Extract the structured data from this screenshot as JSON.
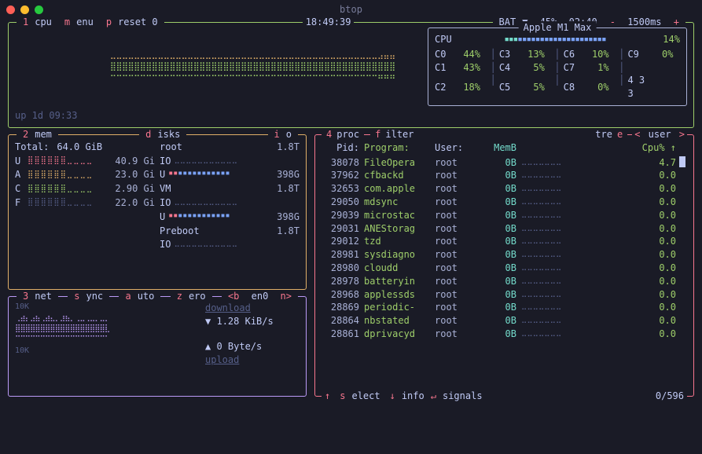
{
  "window": {
    "title": "btop"
  },
  "topbar": {
    "cpu_num": "1",
    "cpu_label": "cpu",
    "menu": {
      "hot": "m",
      "rest": "enu"
    },
    "preset": {
      "hot": "p",
      "rest": "reset 0"
    },
    "clock": "18:49:39",
    "bat_label": "BAT",
    "bat_pct": "45%",
    "bat_time": "02:40",
    "interval_minus": "-",
    "interval": "1500ms",
    "interval_plus": "+"
  },
  "cpu": {
    "model": "Apple M1 Max",
    "overall_label": "CPU",
    "overall_pct": "14%",
    "cores": [
      [
        {
          "n": "C0",
          "v": "44%"
        },
        {
          "n": "C3",
          "v": "13%"
        },
        {
          "n": "C6",
          "v": "10%"
        },
        {
          "n": "C9",
          "v": "0%"
        }
      ],
      [
        {
          "n": "C1",
          "v": "43%"
        },
        {
          "n": "C4",
          "v": "5%"
        },
        {
          "n": "C7",
          "v": "1%"
        },
        {
          "n": "",
          "v": ""
        }
      ],
      [
        {
          "n": "C2",
          "v": "18%"
        },
        {
          "n": "C5",
          "v": "5%"
        },
        {
          "n": "C8",
          "v": "0%"
        },
        {
          "n": "4 3 3",
          "v": ""
        }
      ]
    ],
    "uptime": "up 1d 09:33"
  },
  "mem": {
    "num": "2",
    "label": "mem",
    "disks_label": {
      "hot": "d",
      "rest": "isks"
    },
    "io_label": {
      "hot": "i",
      "rest": "o"
    },
    "total_label": "Total:",
    "total_val": "64.0 GiB",
    "rows": [
      {
        "l": "U",
        "dots_color": "#f7768e",
        "v": "40.9 Gi"
      },
      {
        "l": "A",
        "dots_color": "#e0af68",
        "v": "23.0 Gi"
      },
      {
        "l": "C",
        "dots_color": "#9ece6a",
        "v": "2.90 Gi"
      },
      {
        "l": "F",
        "dots_color": "#565f89",
        "v": "22.0 Gi"
      }
    ],
    "disks": [
      {
        "n": "root",
        "v": "1.8T"
      },
      {
        "n": "IO",
        "v": ""
      },
      {
        "n": "U",
        "v": "398G",
        "bar": true
      },
      {
        "n": "VM",
        "v": "1.8T"
      },
      {
        "n": "IO",
        "v": ""
      },
      {
        "n": "U",
        "v": "398G",
        "bar": true
      },
      {
        "n": "Preboot",
        "v": "1.8T"
      },
      {
        "n": "IO",
        "v": ""
      }
    ]
  },
  "net": {
    "num": "3",
    "label": "net",
    "sync": {
      "hot": "s",
      "rest": "ync"
    },
    "auto": {
      "hot": "a",
      "rest": "uto"
    },
    "zero": {
      "hot": "z",
      "rest": "ero"
    },
    "iface_prev": "<b",
    "iface": "en0",
    "iface_next": "n>",
    "scale_top": "10K",
    "scale_bot": "10K",
    "download_label": "download",
    "download_val": "1.28 KiB/s",
    "upload_val": "0 Byte/s",
    "upload_label": "upload"
  },
  "proc": {
    "num": "4",
    "label": "proc",
    "filter": {
      "hot": "f",
      "rest": "ilter"
    },
    "tree": {
      "hot": "tre",
      "rest": "e"
    },
    "user_nav": "< user >",
    "headers": {
      "pid": "Pid:",
      "prog": "Program:",
      "user": "User:",
      "mem": "MemB",
      "cpu": "Cpu% ↑"
    },
    "rows": [
      {
        "pid": "38078",
        "prog": "FileOpera",
        "user": "root",
        "mem": "0B",
        "cpu": "4.7"
      },
      {
        "pid": "37962",
        "prog": "cfbackd",
        "user": "root",
        "mem": "0B",
        "cpu": "0.0"
      },
      {
        "pid": "32653",
        "prog": "com.apple",
        "user": "root",
        "mem": "0B",
        "cpu": "0.0"
      },
      {
        "pid": "29050",
        "prog": "mdsync",
        "user": "root",
        "mem": "0B",
        "cpu": "0.0"
      },
      {
        "pid": "29039",
        "prog": "microstac",
        "user": "root",
        "mem": "0B",
        "cpu": "0.0"
      },
      {
        "pid": "29031",
        "prog": "ANEStorag",
        "user": "root",
        "mem": "0B",
        "cpu": "0.0"
      },
      {
        "pid": "29012",
        "prog": "tzd",
        "user": "root",
        "mem": "0B",
        "cpu": "0.0"
      },
      {
        "pid": "28981",
        "prog": "sysdiagno",
        "user": "root",
        "mem": "0B",
        "cpu": "0.0"
      },
      {
        "pid": "28980",
        "prog": "cloudd",
        "user": "root",
        "mem": "0B",
        "cpu": "0.0"
      },
      {
        "pid": "28978",
        "prog": "batteryin",
        "user": "root",
        "mem": "0B",
        "cpu": "0.0"
      },
      {
        "pid": "28968",
        "prog": "applessds",
        "user": "root",
        "mem": "0B",
        "cpu": "0.0"
      },
      {
        "pid": "28869",
        "prog": "periodic-",
        "user": "root",
        "mem": "0B",
        "cpu": "0.0"
      },
      {
        "pid": "28864",
        "prog": "nbstated",
        "user": "root",
        "mem": "0B",
        "cpu": "0.0"
      },
      {
        "pid": "28861",
        "prog": "dprivacyd",
        "user": "root",
        "mem": "0B",
        "cpu": "0.0"
      }
    ],
    "footer": {
      "up": "↑",
      "select": {
        "hot": "s",
        "rest": "elect"
      },
      "down": "↓",
      "info": "info",
      "enter": "↵",
      "signals": "signals",
      "count": "0/596"
    }
  }
}
